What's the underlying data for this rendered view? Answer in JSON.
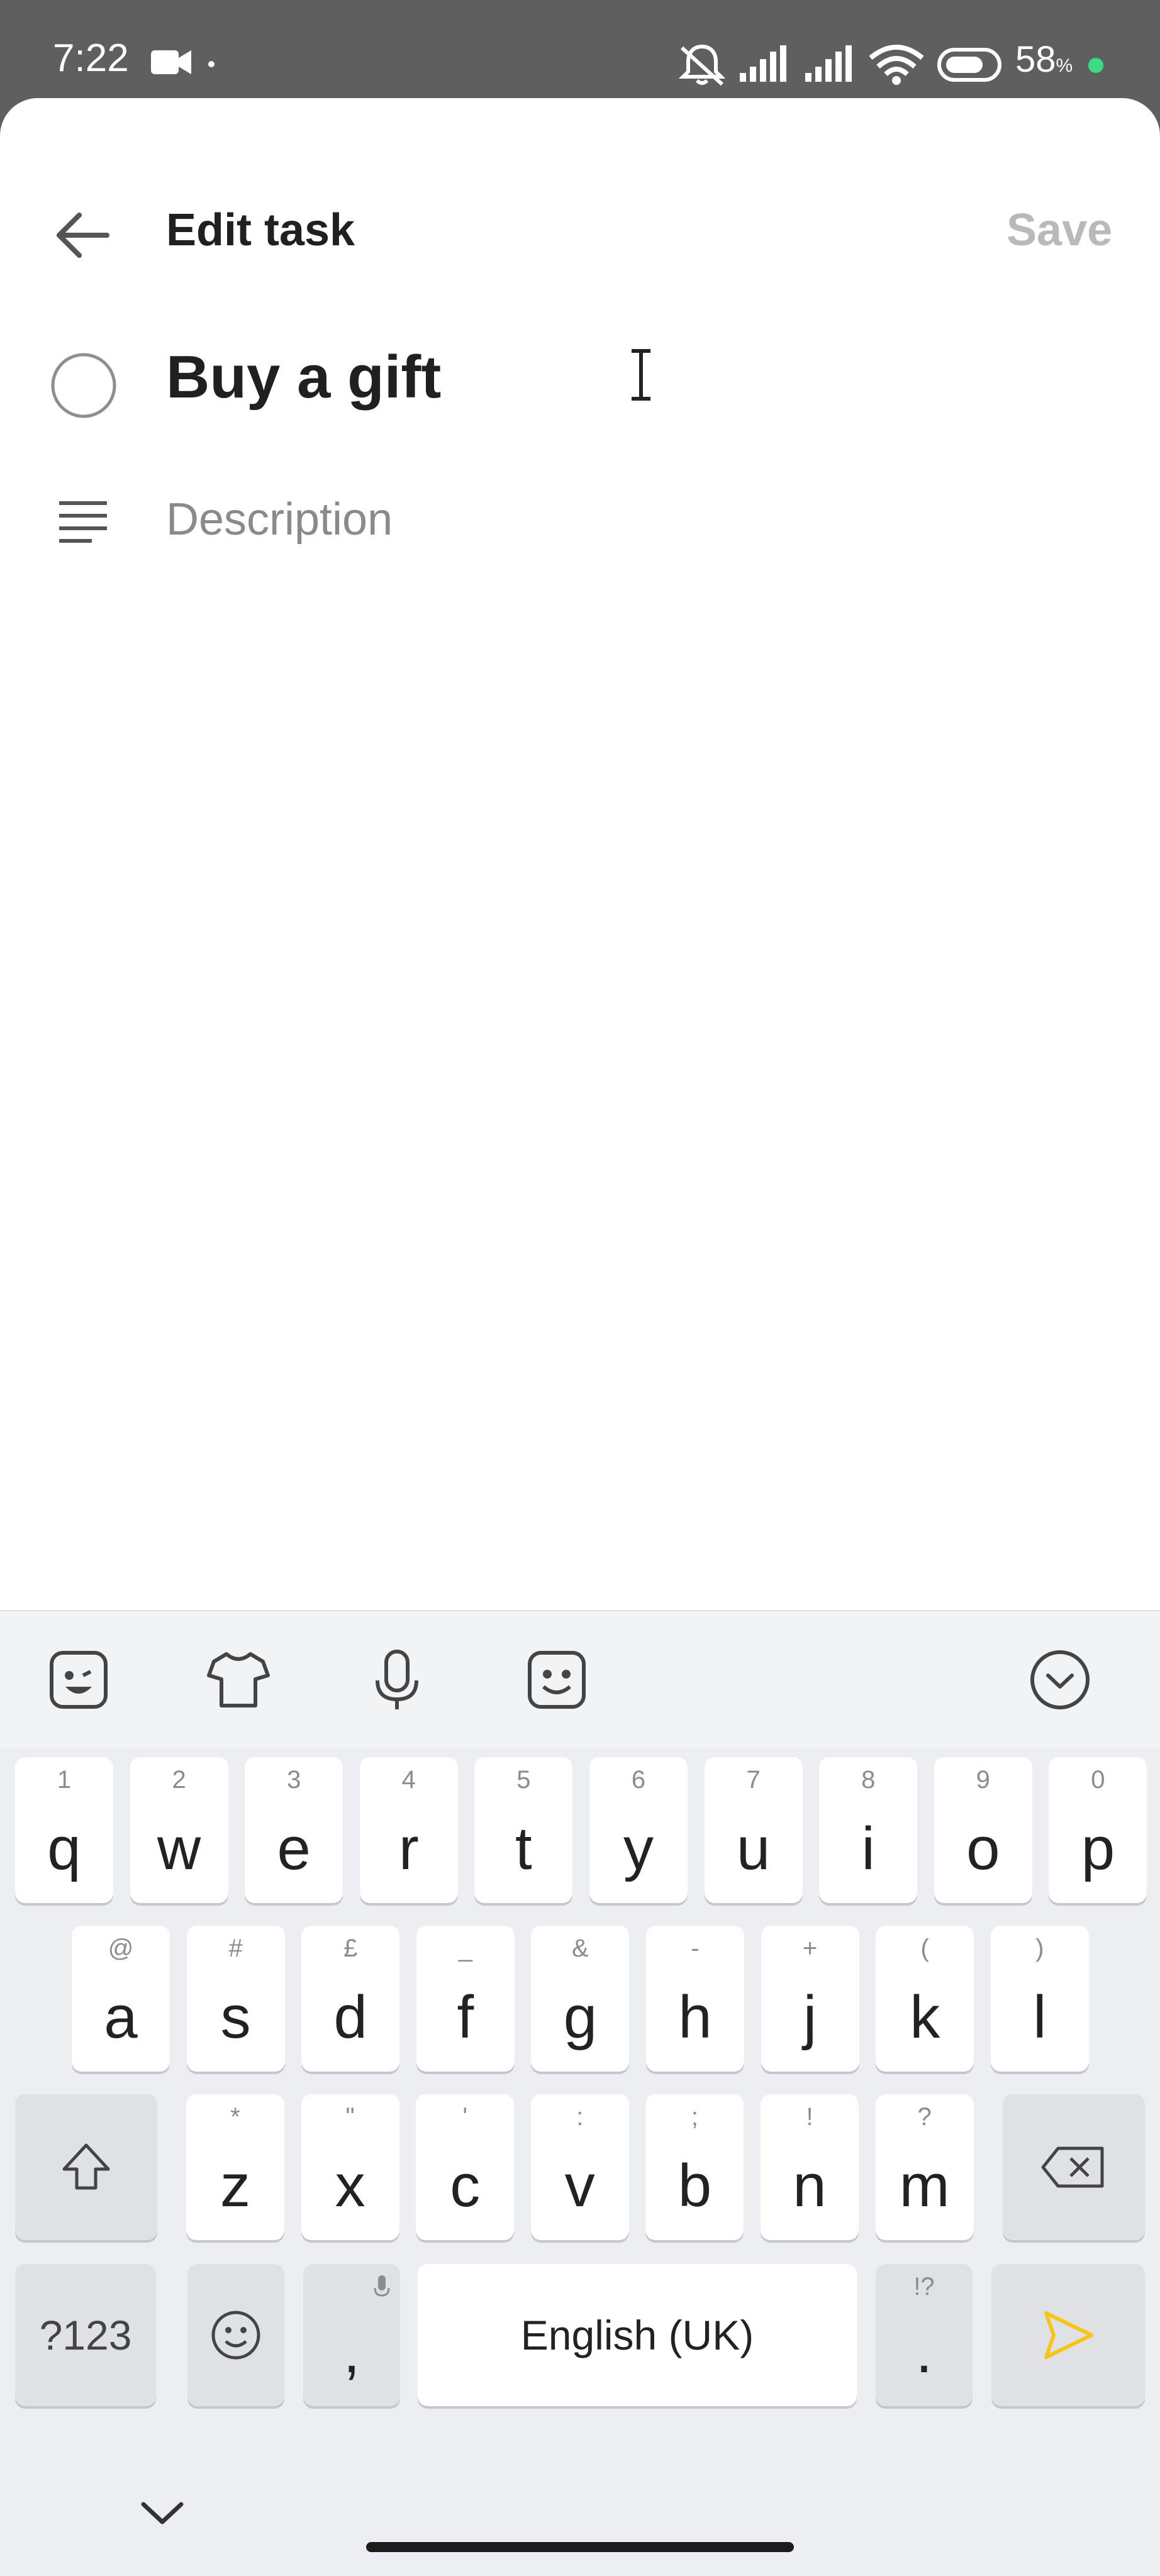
{
  "status_bar": {
    "time": "7:22",
    "battery_percent": "58",
    "battery_unit": "%",
    "battery_dot_color": "#3ddc84",
    "icons": [
      "video-camera-icon",
      "dot-icon",
      "silent-mode-icon",
      "signal-icon",
      "signal-icon",
      "wifi-icon",
      "battery-icon"
    ]
  },
  "header": {
    "back_icon": "arrow-left-icon",
    "title": "Edit task",
    "save_label": "Save"
  },
  "task": {
    "complete_icon": "circle-checkbox-icon",
    "title": "Buy a gift",
    "description_icon": "description-lines-icon",
    "description_placeholder": "Description"
  },
  "keyboard": {
    "toolbar_icons": [
      "sticker-icon",
      "theme-shirt-icon",
      "microphone-icon",
      "emoji-sticker-icon",
      "collapse-chevron-icon"
    ],
    "row1": [
      {
        "letter": "q",
        "hint": "1"
      },
      {
        "letter": "w",
        "hint": "2"
      },
      {
        "letter": "e",
        "hint": "3"
      },
      {
        "letter": "r",
        "hint": "4"
      },
      {
        "letter": "t",
        "hint": "5"
      },
      {
        "letter": "y",
        "hint": "6"
      },
      {
        "letter": "u",
        "hint": "7"
      },
      {
        "letter": "i",
        "hint": "8"
      },
      {
        "letter": "o",
        "hint": "9"
      },
      {
        "letter": "p",
        "hint": "0"
      }
    ],
    "row2": [
      {
        "letter": "a",
        "hint": "@"
      },
      {
        "letter": "s",
        "hint": "#"
      },
      {
        "letter": "d",
        "hint": "£"
      },
      {
        "letter": "f",
        "hint": "_"
      },
      {
        "letter": "g",
        "hint": "&"
      },
      {
        "letter": "h",
        "hint": "-"
      },
      {
        "letter": "j",
        "hint": "+"
      },
      {
        "letter": "k",
        "hint": "("
      },
      {
        "letter": "l",
        "hint": ")"
      }
    ],
    "row3": [
      {
        "letter": "z",
        "hint": "*"
      },
      {
        "letter": "x",
        "hint": "\""
      },
      {
        "letter": "c",
        "hint": "'"
      },
      {
        "letter": "v",
        "hint": ":"
      },
      {
        "letter": "b",
        "hint": ";"
      },
      {
        "letter": "n",
        "hint": "!"
      },
      {
        "letter": "m",
        "hint": "?"
      }
    ],
    "symbols_label": "?123",
    "comma": ",",
    "space_label": "English (UK)",
    "period": ".",
    "period_hint": "!?",
    "send_color": "#f5c518",
    "hide_keyboard_icon": "chevron-down-icon"
  }
}
